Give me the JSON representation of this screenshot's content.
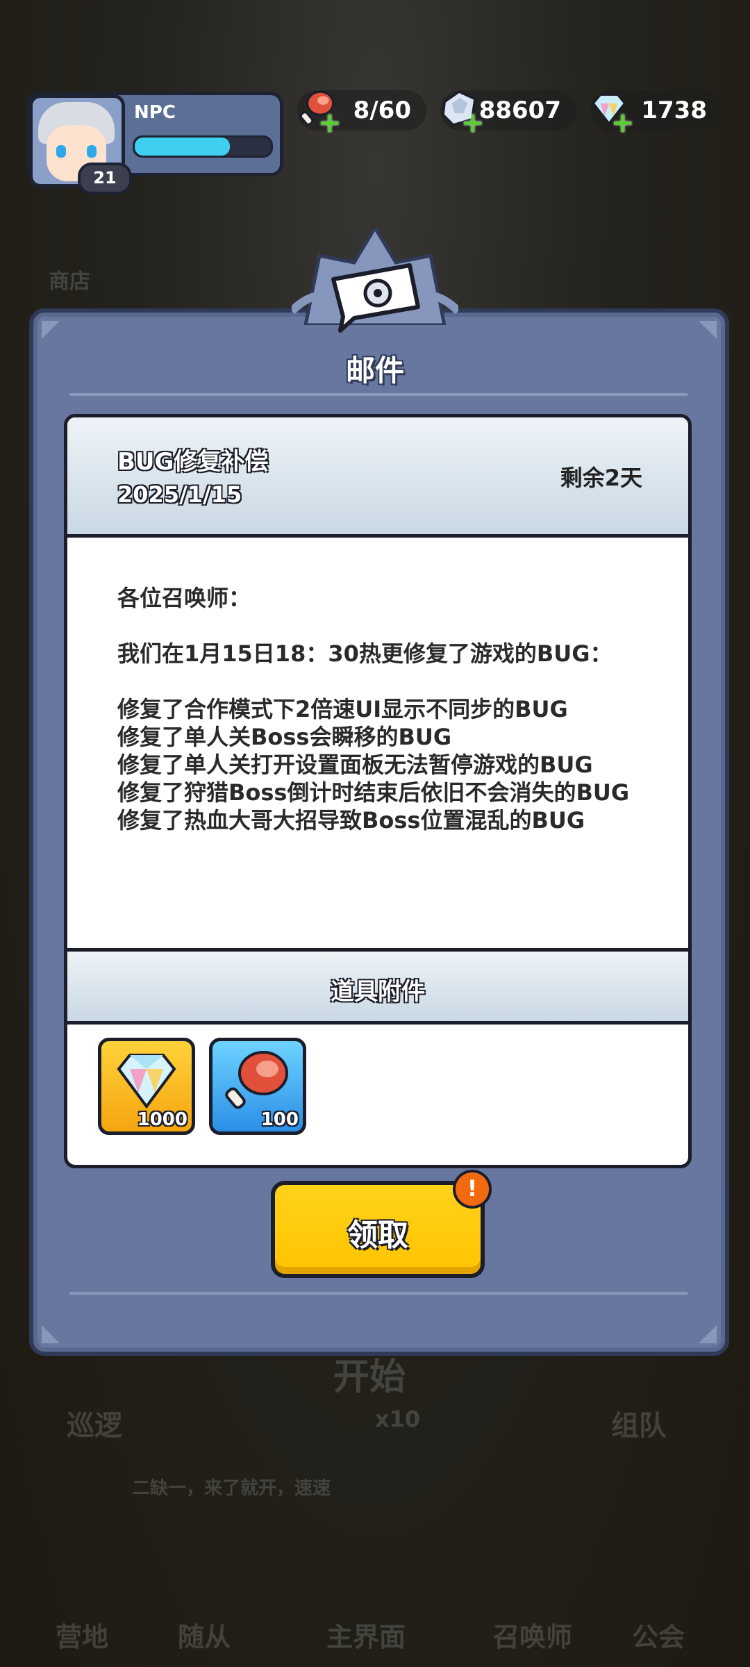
{
  "player": {
    "name": "NPC",
    "level": "21",
    "xp_fraction": 0.7
  },
  "resources": {
    "stamina": {
      "value": "8/60",
      "icon": "meat-icon"
    },
    "crystals": {
      "value": "88607",
      "icon": "crystal-icon"
    },
    "diamonds": {
      "value": "1738",
      "icon": "diamond-icon"
    }
  },
  "dialog": {
    "title": "邮件",
    "mail": {
      "subject": "BUG修复补偿",
      "date": "2025/1/15",
      "remaining": "剩余2天",
      "greeting": "各位召唤师：",
      "intro": "我们在1月15日18：30热更修复了游戏的BUG：",
      "fixes": [
        "修复了合作模式下2倍速UI显示不同步的BUG",
        "修复了单人关Boss会瞬移的BUG",
        "修复了单人关打开设置面板无法暂停游戏的BUG",
        "修复了狩猎Boss倒计时结束后依旧不会消失的BUG",
        "修复了热血大哥大招导致Boss位置混乱的BUG"
      ]
    },
    "attachments_title": "道具附件",
    "attachments": [
      {
        "icon": "diamond-icon",
        "count": "1000"
      },
      {
        "icon": "meat-icon",
        "count": "100"
      }
    ],
    "claim_label": "领取",
    "claim_alert": "!"
  },
  "background": {
    "shop": "商店",
    "patrol": "巡逻",
    "start": "开始",
    "start_cost": "x10",
    "team": "组队",
    "chat": "二缺一，来了就开，速速",
    "nav": [
      "营地",
      "随从",
      "主界面",
      "召唤师",
      "公会"
    ]
  },
  "colors": {
    "dialog": "#6877a0",
    "button": "#ffc400",
    "xp": "#3fd0ef"
  }
}
